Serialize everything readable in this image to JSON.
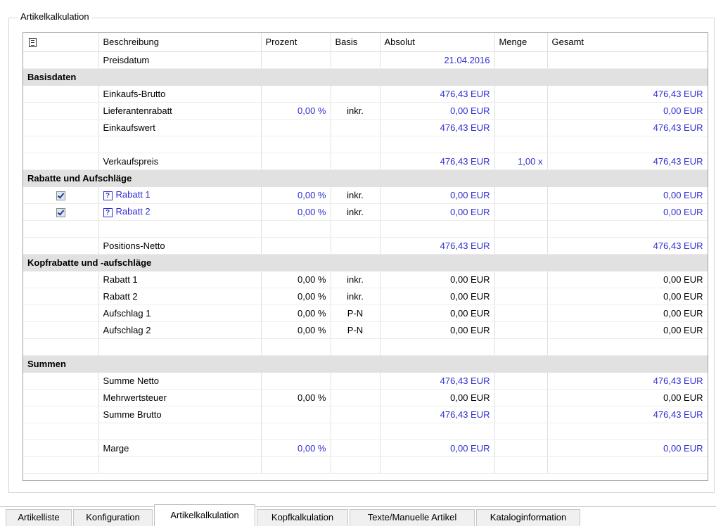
{
  "group_title": "Artikelkalkulation",
  "header": {
    "icon": "list-icon",
    "beschreibung": "Beschreibung",
    "prozent": "Prozent",
    "basis": "Basis",
    "absolut": "Absolut",
    "menge": "Menge",
    "gesamt": "Gesamt"
  },
  "rows": [
    {
      "kind": "data",
      "desc": "Preisdatum",
      "prozent": "",
      "basis": "",
      "absolut": "21.04.2016",
      "menge": "",
      "gesamt": "",
      "abs_blue": true,
      "ges_blue": false,
      "pct_blue": false
    },
    {
      "kind": "section",
      "title": "Basisdaten"
    },
    {
      "kind": "data",
      "desc": "Einkaufs-Brutto",
      "prozent": "",
      "basis": "",
      "absolut": "476,43 EUR",
      "menge": "",
      "gesamt": "476,43 EUR",
      "abs_blue": true,
      "ges_blue": true,
      "pct_blue": false
    },
    {
      "kind": "data",
      "desc": "Lieferantenrabatt",
      "prozent": "0,00 %",
      "basis": "inkr.",
      "absolut": "0,00 EUR",
      "menge": "",
      "gesamt": "0,00 EUR",
      "abs_blue": true,
      "ges_blue": true,
      "pct_blue": true
    },
    {
      "kind": "data",
      "desc": "Einkaufswert",
      "prozent": "",
      "basis": "",
      "absolut": "476,43 EUR",
      "menge": "",
      "gesamt": "476,43 EUR",
      "abs_blue": true,
      "ges_blue": true,
      "pct_blue": false
    },
    {
      "kind": "empty"
    },
    {
      "kind": "data",
      "desc": "Verkaufspreis",
      "prozent": "",
      "basis": "",
      "absolut": "476,43 EUR",
      "menge": "1,00 x",
      "gesamt": "476,43 EUR",
      "abs_blue": true,
      "ges_blue": true,
      "pct_blue": false
    },
    {
      "kind": "section",
      "title": "Rabatte und Aufschläge"
    },
    {
      "kind": "data",
      "checked": true,
      "help": true,
      "desc": "Rabatt 1",
      "desc_blue": true,
      "prozent": "0,00 %",
      "basis": "inkr.",
      "absolut": "0,00 EUR",
      "menge": "",
      "gesamt": "0,00 EUR",
      "abs_blue": true,
      "ges_blue": true,
      "pct_blue": true
    },
    {
      "kind": "data",
      "checked": true,
      "help": true,
      "desc": "Rabatt 2",
      "desc_blue": true,
      "prozent": "0,00 %",
      "basis": "inkr.",
      "absolut": "0,00 EUR",
      "menge": "",
      "gesamt": "0,00 EUR",
      "abs_blue": true,
      "ges_blue": true,
      "pct_blue": true
    },
    {
      "kind": "empty"
    },
    {
      "kind": "data",
      "desc": "Positions-Netto",
      "prozent": "",
      "basis": "",
      "absolut": "476,43 EUR",
      "menge": "",
      "gesamt": "476,43 EUR",
      "abs_blue": true,
      "ges_blue": true,
      "pct_blue": false
    },
    {
      "kind": "section",
      "title": "Kopfrabatte und -aufschläge"
    },
    {
      "kind": "data",
      "desc": "Rabatt 1",
      "prozent": "0,00 %",
      "basis": "inkr.",
      "absolut": "0,00 EUR",
      "menge": "",
      "gesamt": "0,00 EUR",
      "abs_blue": false,
      "ges_blue": false,
      "pct_blue": false
    },
    {
      "kind": "data",
      "desc": "Rabatt 2",
      "prozent": "0,00 %",
      "basis": "inkr.",
      "absolut": "0,00 EUR",
      "menge": "",
      "gesamt": "0,00 EUR",
      "abs_blue": false,
      "ges_blue": false,
      "pct_blue": false
    },
    {
      "kind": "data",
      "desc": "Aufschlag 1",
      "prozent": "0,00 %",
      "basis": "P-N",
      "absolut": "0,00 EUR",
      "menge": "",
      "gesamt": "0,00 EUR",
      "abs_blue": false,
      "ges_blue": false,
      "pct_blue": false
    },
    {
      "kind": "data",
      "desc": "Aufschlag 2",
      "prozent": "0,00 %",
      "basis": "P-N",
      "absolut": "0,00 EUR",
      "menge": "",
      "gesamt": "0,00 EUR",
      "abs_blue": false,
      "ges_blue": false,
      "pct_blue": false
    },
    {
      "kind": "empty"
    },
    {
      "kind": "section",
      "title": "Summen"
    },
    {
      "kind": "data",
      "desc": "Summe Netto",
      "prozent": "",
      "basis": "",
      "absolut": "476,43 EUR",
      "menge": "",
      "gesamt": "476,43 EUR",
      "abs_blue": true,
      "ges_blue": true,
      "pct_blue": false
    },
    {
      "kind": "data",
      "desc": "Mehrwertsteuer",
      "prozent": "0,00 %",
      "basis": "",
      "absolut": "0,00 EUR",
      "menge": "",
      "gesamt": "0,00 EUR",
      "abs_blue": false,
      "ges_blue": false,
      "pct_blue": false
    },
    {
      "kind": "data",
      "desc": "Summe Brutto",
      "prozent": "",
      "basis": "",
      "absolut": "476,43 EUR",
      "menge": "",
      "gesamt": "476,43 EUR",
      "abs_blue": true,
      "ges_blue": true,
      "pct_blue": false
    },
    {
      "kind": "empty"
    },
    {
      "kind": "data",
      "desc": "Marge",
      "prozent": "0,00 %",
      "basis": "",
      "absolut": "0,00 EUR",
      "menge": "",
      "gesamt": "0,00 EUR",
      "abs_blue": true,
      "ges_blue": true,
      "pct_blue": true
    },
    {
      "kind": "empty"
    }
  ],
  "tabs": [
    {
      "label": "Artikelliste",
      "active": false
    },
    {
      "label": "Konfiguration",
      "active": false
    },
    {
      "label": "Artikelkalkulation",
      "active": true
    },
    {
      "label": "Kopfkalkulation",
      "active": false
    },
    {
      "label": "Texte/Manuelle Artikel",
      "active": false
    },
    {
      "label": "Kataloginformation",
      "active": false
    }
  ],
  "colors": {
    "value_blue": "#2d2dd3",
    "section_bg": "#e1e1e1"
  }
}
